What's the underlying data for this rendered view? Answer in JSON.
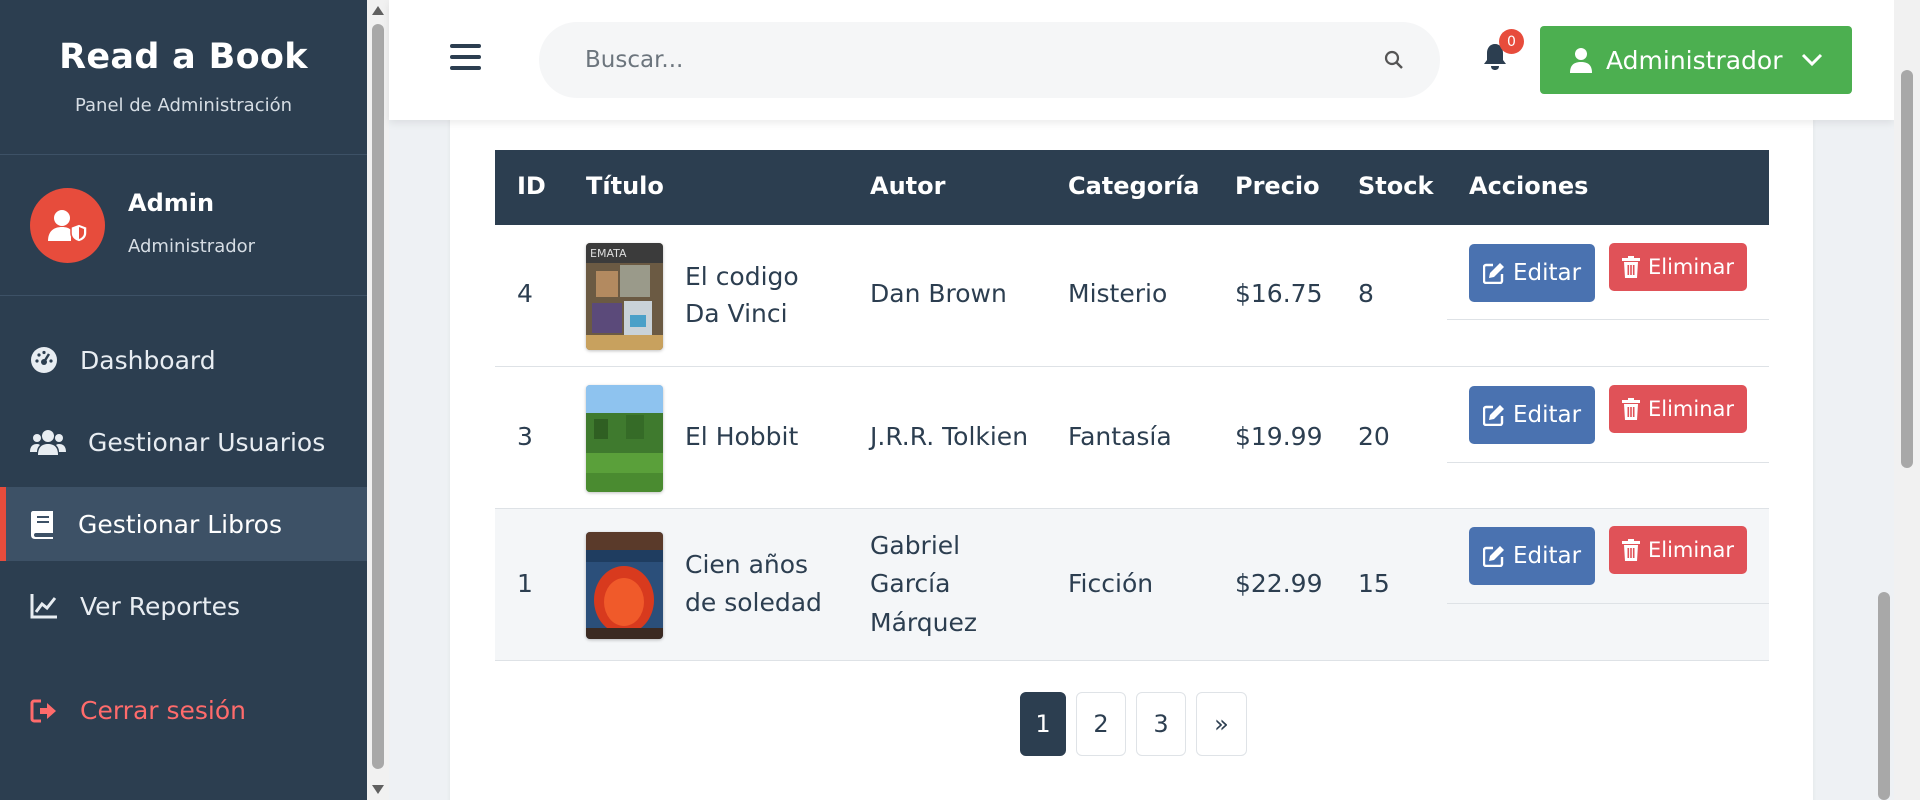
{
  "sidebar": {
    "brand_title": "Read a Book",
    "brand_subtitle": "Panel de Administración",
    "profile": {
      "name": "Admin",
      "role": "Administrador"
    },
    "nav": [
      {
        "label": "Dashboard",
        "icon": "gauge-icon",
        "active": false
      },
      {
        "label": "Gestionar Usuarios",
        "icon": "users-icon",
        "active": false
      },
      {
        "label": "Gestionar Libros",
        "icon": "book-icon",
        "active": true
      },
      {
        "label": "Ver Reportes",
        "icon": "chart-line-icon",
        "active": false
      }
    ],
    "logout_label": "Cerrar sesión"
  },
  "topbar": {
    "search_placeholder": "Buscar...",
    "notifications_count": "0",
    "user_menu_label": "Administrador"
  },
  "table": {
    "headers": [
      "ID",
      "Título",
      "Autor",
      "Categoría",
      "Precio",
      "Stock",
      "Acciones"
    ],
    "rows": [
      {
        "id": "4",
        "title_line1": "El codigo",
        "title_line2": "Da Vinci",
        "author_line1": "Dan Brown",
        "author_line2": "",
        "author_line3": "",
        "category": "Misterio",
        "price": "$16.75",
        "stock": "8",
        "edit": "Editar",
        "delete": "Eliminar"
      },
      {
        "id": "3",
        "title_line1": "El Hobbit",
        "title_line2": "",
        "author_line1": "J.R.R. Tolkien",
        "author_line2": "",
        "author_line3": "",
        "category": "Fantasía",
        "price": "$19.99",
        "stock": "20",
        "edit": "Editar",
        "delete": "Eliminar"
      },
      {
        "id": "1",
        "title_line1": "Cien años",
        "title_line2": "de soledad",
        "author_line1": "Gabriel",
        "author_line2": "García",
        "author_line3": "Márquez",
        "category": "Ficción",
        "price": "$22.99",
        "stock": "15",
        "edit": "Editar",
        "delete": "Eliminar"
      }
    ]
  },
  "pagination": {
    "pages": [
      "1",
      "2",
      "3"
    ],
    "next": "»",
    "current": "1"
  },
  "colors": {
    "sidebar": "#2c3e50",
    "accent_red": "#e74c3c",
    "user_button": "#4caf50",
    "edit_button": "#4a72b0",
    "delete_button": "#e05258"
  }
}
